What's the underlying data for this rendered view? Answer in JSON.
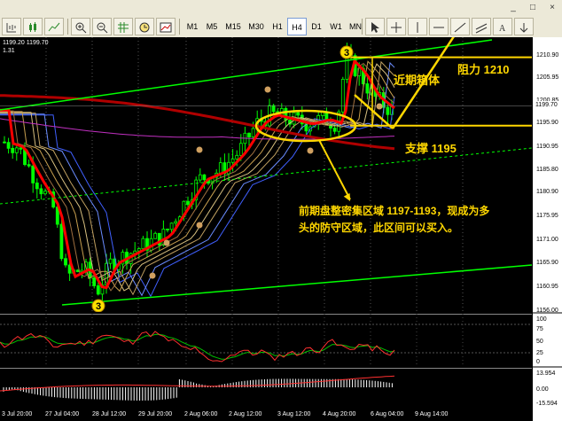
{
  "toolbar": {
    "timeframes": [
      "M1",
      "M5",
      "M15",
      "M30",
      "H1",
      "H4",
      "D1",
      "W1",
      "MN"
    ],
    "active_timeframe": "H4"
  },
  "window": {
    "minimize": "_",
    "restore": "□",
    "close": "×"
  },
  "header": {
    "line1": "1199.20 1199.70",
    "line2": "1.31"
  },
  "price_axis": [
    "1210.90",
    "1205.95",
    "1200.85",
    "1195.90",
    "1190.95",
    "1185.80",
    "1180.90",
    "1175.95",
    "1171.00",
    "1165.90",
    "1160.95",
    "1156.00"
  ],
  "current_price": "1199.70",
  "osc1_axis": [
    "100",
    "75",
    "50",
    "25",
    "0"
  ],
  "osc2_axis": [
    "13.954",
    "0.00",
    "-15.594"
  ],
  "date_labels": [
    "3 Jul 20:00",
    "27 Jul 04:00",
    "28 Jul 12:00",
    "29 Jul 20:00",
    "2 Aug 06:00",
    "2 Aug 12:00",
    "3 Aug 12:00",
    "4 Aug 20:00",
    "6 Aug 04:00",
    "9 Aug 14:00"
  ],
  "annotations": {
    "recent_box": "近期箱体",
    "resistance": "阻力 1210",
    "support": "支撑 1195",
    "note_line1": "前期盘整密集区域 1197-1193，现成为多",
    "note_line2": "头的防守区域，此区间可以买入。",
    "wave_top": "3",
    "wave_bottom": "3"
  },
  "colors": {
    "bull": "#00ff00",
    "bear": "#00ff00",
    "ma_red": "#ff0000",
    "ma_dark_red": "#b00000",
    "channel": "#00ff00",
    "annot": "#ffd700",
    "osc_red": "#ff3030",
    "osc_green": "#00c000"
  }
}
